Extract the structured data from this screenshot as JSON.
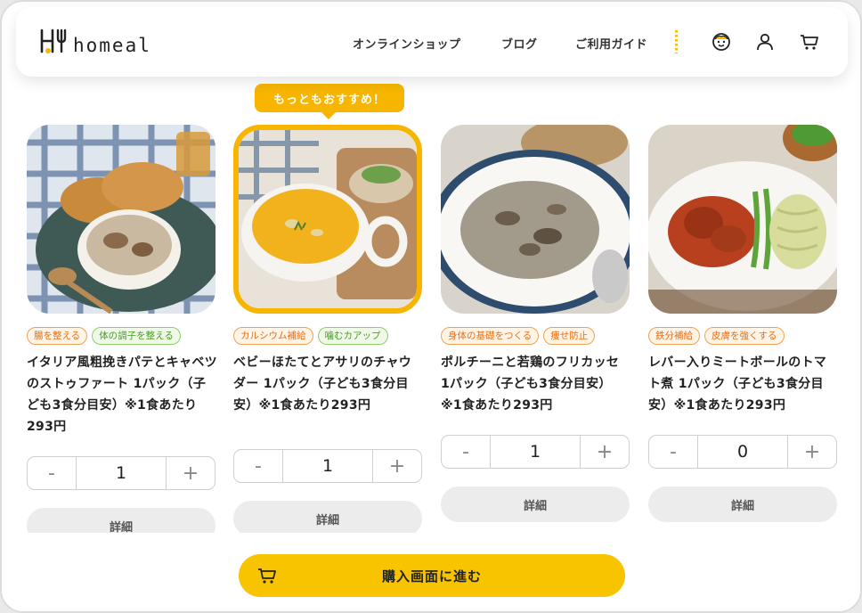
{
  "brand": {
    "name": "homeal"
  },
  "nav": {
    "items": [
      "オンラインショップ",
      "ブログ",
      "ご利用ガイド"
    ]
  },
  "icons": {
    "face": "smiley-face-icon",
    "user": "user-icon",
    "cart": "cart-icon"
  },
  "callout": "もっともおすすめ！",
  "products": [
    {
      "tags": [
        {
          "text": "腸を整える",
          "color": "orange"
        },
        {
          "text": "体の調子を整える",
          "color": "green"
        }
      ],
      "name": "イタリア風粗挽きパテとキャベツのストゥファート 1パック（子ども3食分目安）※1食あたり293円",
      "quantity": "1",
      "detail": "詳細"
    },
    {
      "tags": [
        {
          "text": "カルシウム補給",
          "color": "orange"
        },
        {
          "text": "噛むカアップ",
          "color": "green"
        }
      ],
      "name": "ベビーほたてとアサリのチャウダー 1パック（子ども3食分目安）※1食あたり293円",
      "quantity": "1",
      "detail": "詳細"
    },
    {
      "tags": [
        {
          "text": "身体の基礎をつくる",
          "color": "orange"
        },
        {
          "text": "痩せ防止",
          "color": "orange"
        }
      ],
      "name": "ポルチーニと若鶏のフリカッセ 1パック（子ども3食分目安）※1食あたり293円",
      "quantity": "1",
      "detail": "詳細"
    },
    {
      "tags": [
        {
          "text": "鉄分補給",
          "color": "orange"
        },
        {
          "text": "皮膚を強くする",
          "color": "orange"
        }
      ],
      "name": "レバー入りミートボールのトマト煮 1パック（子ども3食分目安）※1食あたり293円",
      "quantity": "0",
      "detail": "詳細"
    }
  ],
  "stepper": {
    "minus": "-",
    "plus": "+"
  },
  "checkout": {
    "label": "購入画面に進む"
  }
}
